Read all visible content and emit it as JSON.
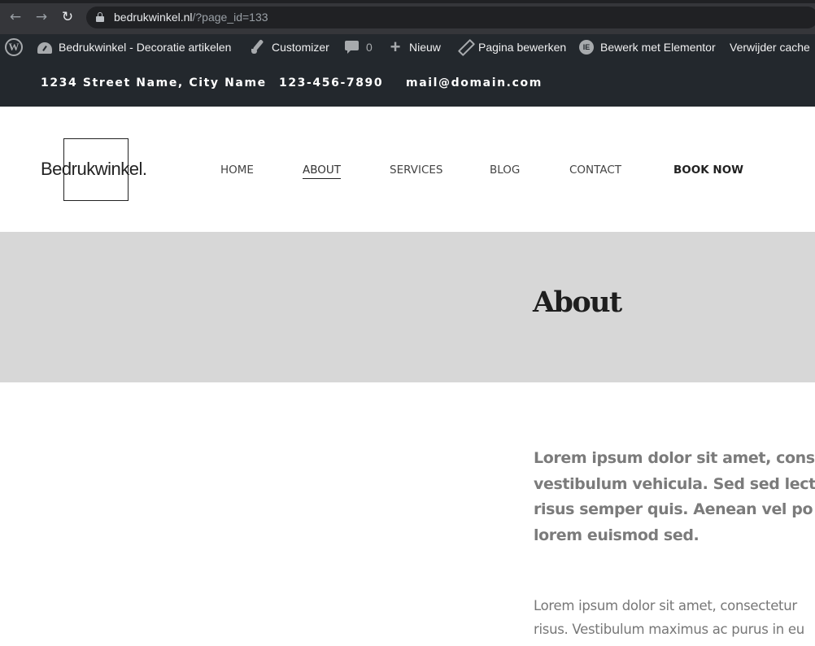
{
  "browser": {
    "url_host": "bedrukwinkel.nl",
    "url_path": "/?page_id=133"
  },
  "admin_bar": {
    "site_name": "Bedrukwinkel - Decoratie artikelen",
    "customizer": "Customizer",
    "comments_count": "0",
    "new": "Nieuw",
    "edit_page": "Pagina bewerken",
    "elementor": "Bewerk met Elementor",
    "clear_cache": "Verwijder cache"
  },
  "topbar": {
    "address": "1234 Street Name, City Name",
    "phone": "123-456-7890",
    "email": "mail@domain.com"
  },
  "logo": {
    "text": "Bedrukwinkel."
  },
  "nav": {
    "items": [
      {
        "label": "HOME"
      },
      {
        "label": "ABOUT"
      },
      {
        "label": "SERVICES"
      },
      {
        "label": "BLOG"
      },
      {
        "label": "CONTACT"
      },
      {
        "label": "BOOK NOW"
      }
    ]
  },
  "hero": {
    "title": "About"
  },
  "content": {
    "lead_lines": [
      "Lorem ipsum dolor sit amet, cons",
      "vestibulum vehicula. Sed sed lect",
      "risus semper quis. Aenean vel po",
      "lorem euismod sed."
    ],
    "body_lines": [
      "Lorem ipsum dolor sit amet, consectetur",
      "risus. Vestibulum maximus ac purus in eu"
    ]
  },
  "colors": {
    "admin_bar_bg": "#23282d",
    "hero_bg": "#d7d7d7",
    "text_gray": "#7b7b7b"
  }
}
